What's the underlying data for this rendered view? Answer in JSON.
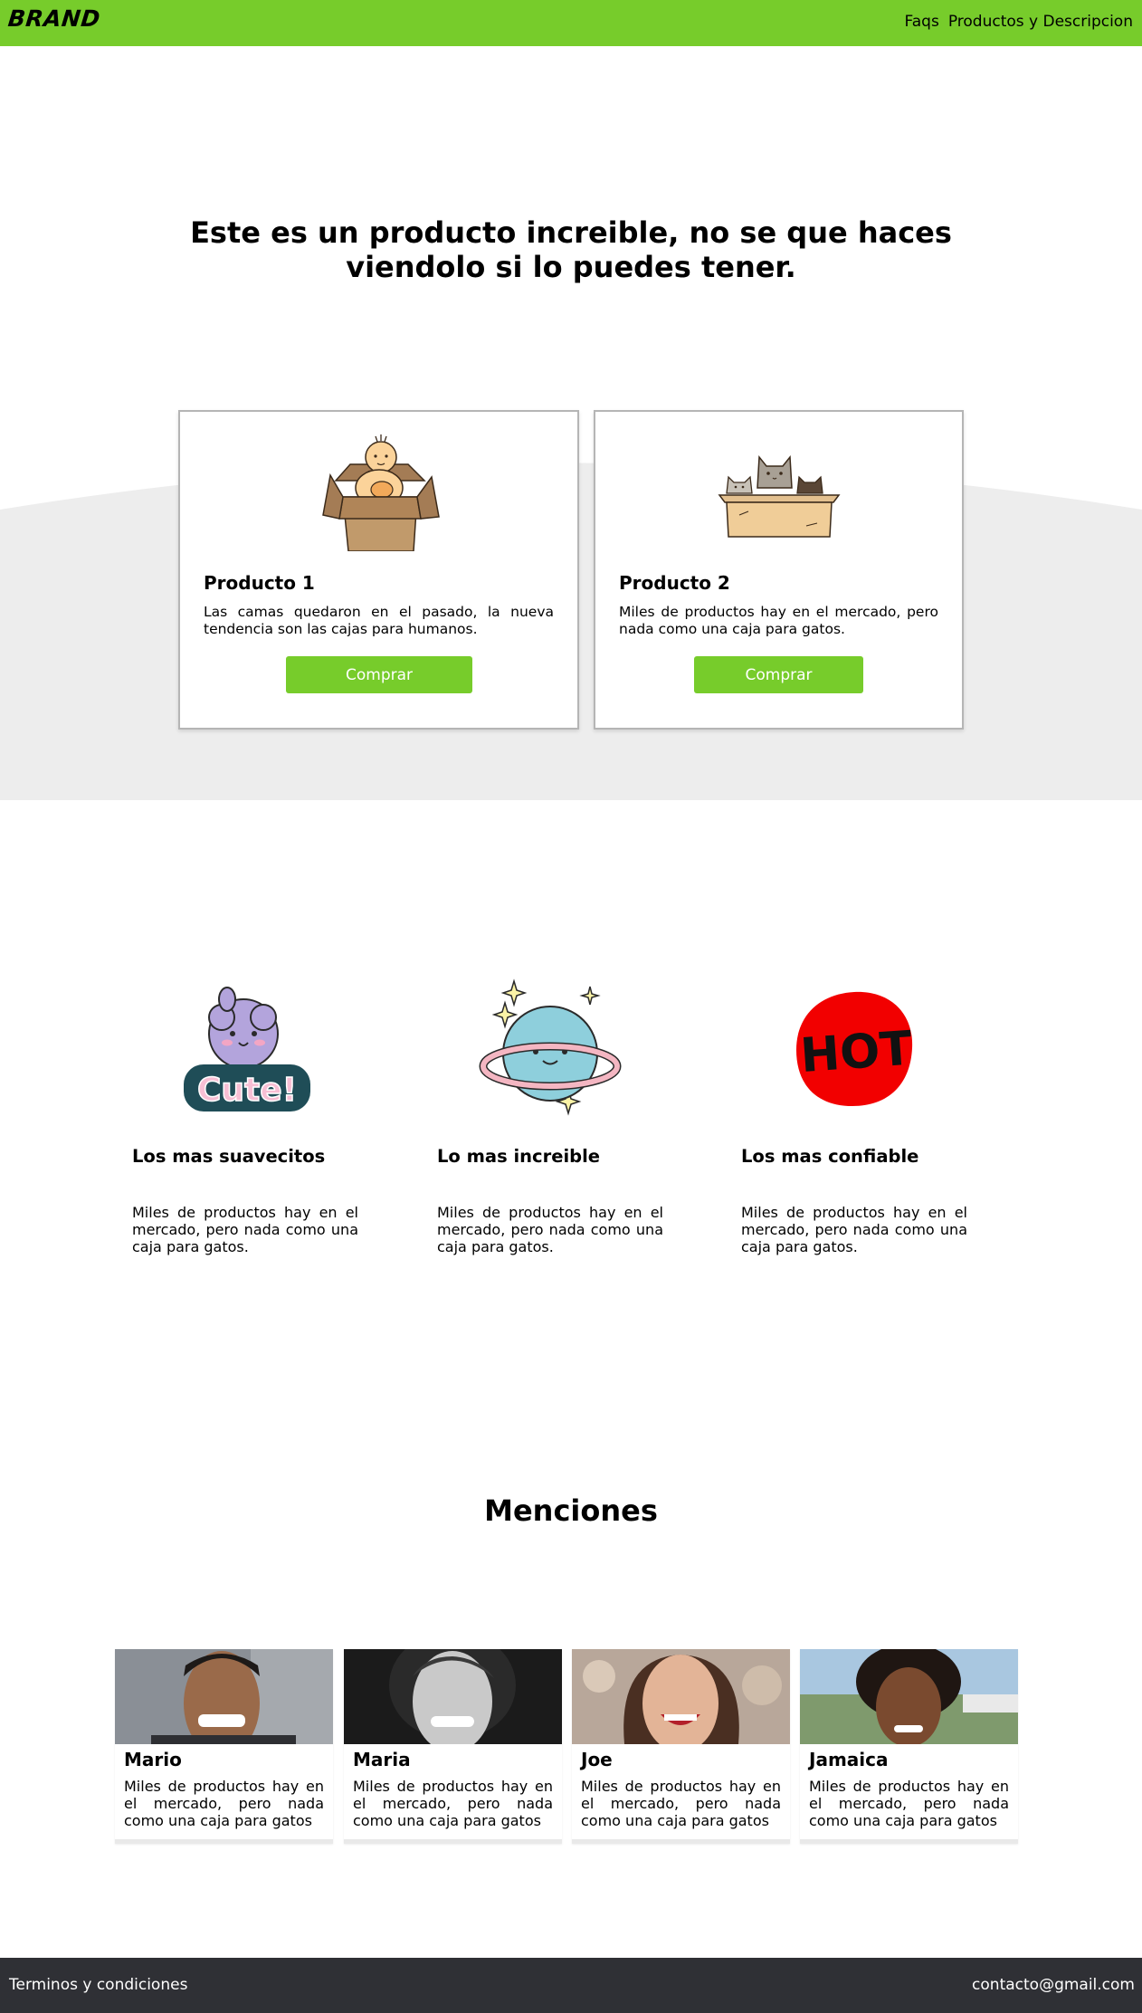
{
  "nav": {
    "brand": "BRAND",
    "links": [
      "Faqs",
      "Productos y Descripcion"
    ]
  },
  "hero": {
    "title": "Este es un producto increible, no se que haces viendolo si lo puedes tener."
  },
  "products": [
    {
      "name": "Producto 1",
      "description": "Las camas quedaron en el pasado, la nueva tendencia son las cajas para humanos.",
      "button": "Comprar",
      "image_icon": "baby-in-box-illustration"
    },
    {
      "name": "Producto 2",
      "description": "Miles de productos hay en el mercado, pero nada como una caja para gatos.",
      "button": "Comprar",
      "image_icon": "cats-in-box-illustration"
    }
  ],
  "features": [
    {
      "title": "Los mas suavecitos",
      "description": "Miles de productos hay en el mercado, pero nada como una caja para gatos.",
      "image_icon": "cute-sticker-illustration",
      "sticker_text": "Cute!"
    },
    {
      "title": "Lo mas increible",
      "description": "Miles de productos hay en el mercado, pero nada como una caja para gatos.",
      "image_icon": "planet-illustration"
    },
    {
      "title": "Los mas confiable",
      "description": "Miles de productos hay en el mercado, pero nada como una caja para gatos.",
      "image_icon": "hot-badge-illustration",
      "sticker_text": "HOT"
    }
  ],
  "mentions": {
    "title": "Menciones",
    "people": [
      {
        "name": "Mario",
        "description": "Miles de productos hay en el mercado, pero nada como una caja para gatos"
      },
      {
        "name": "Maria",
        "description": "Miles de productos hay en el mercado, pero nada como una caja para gatos"
      },
      {
        "name": "Joe",
        "description": "Miles de productos hay en el mercado, pero nada como una caja para gatos"
      },
      {
        "name": "Jamaica",
        "description": "Miles de productos hay en el mercado, pero nada como una caja para gatos"
      }
    ]
  },
  "footer": {
    "left": "Terminos y condiciones",
    "right": "contacto@gmail.com"
  },
  "colors": {
    "accent": "#77cc2b",
    "band_gray": "#ededed",
    "footer_bg": "#2f3035",
    "hot_red": "#f20000"
  }
}
